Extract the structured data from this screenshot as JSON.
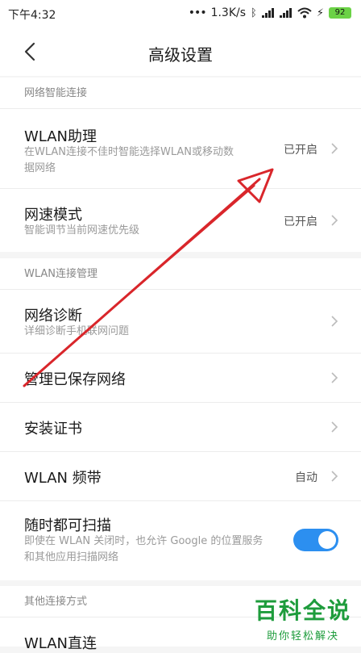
{
  "status_bar": {
    "time": "下午4:32",
    "speed": "1.3K/s",
    "battery": "92"
  },
  "header": {
    "title": "高级设置"
  },
  "sections": [
    {
      "header": "网络智能连接",
      "rows": [
        {
          "title": "WLAN助理",
          "subtitle_line1": "在WLAN连接不佳时智能选择WLAN或移动数",
          "subtitle_line2": "据网络",
          "value": "已开启"
        },
        {
          "title": "网速模式",
          "subtitle": "智能调节当前网速优先级",
          "value": "已开启"
        }
      ]
    },
    {
      "header": "WLAN连接管理",
      "rows": [
        {
          "title": "网络诊断",
          "subtitle": "详细诊断手机联网问题"
        },
        {
          "title": "管理已保存网络"
        },
        {
          "title": "安装证书"
        },
        {
          "title": "WLAN 频带",
          "value": "自动"
        },
        {
          "title": "随时都可扫描",
          "subtitle_line1": "即使在 WLAN 关闭时，也允许 Google 的位置服务",
          "subtitle_line2": "和其他应用扫描网络",
          "toggle_on": true
        }
      ]
    },
    {
      "header": "其他连接方式",
      "rows": [
        {
          "title": "WLAN直连"
        }
      ]
    }
  ],
  "watermark": {
    "title": "百科全说",
    "subtitle": "助你轻松解决"
  },
  "colors": {
    "toggle": "#2c8ff0",
    "annotation_arrow": "#d9262b",
    "watermark": "#1e9c3c",
    "battery": "#6bd246"
  }
}
